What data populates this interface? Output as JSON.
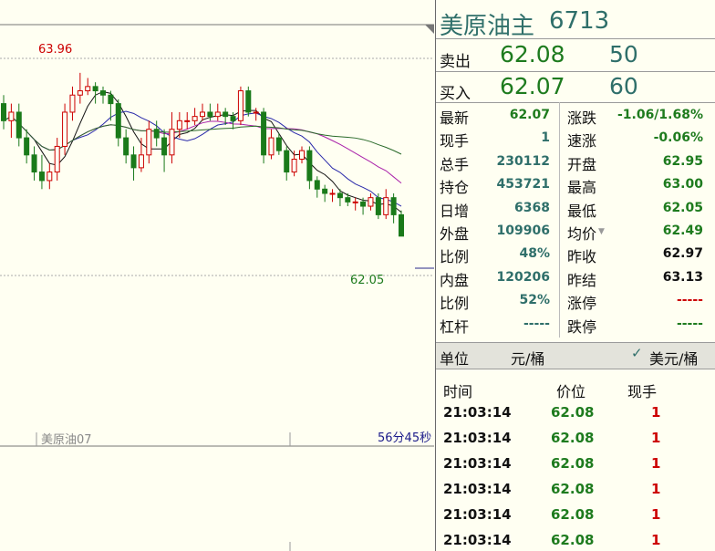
{
  "chart": {
    "high_label": "63.96",
    "low_label": "62.05",
    "contract_label": "美原油07",
    "countdown_label": "56分45秒"
  },
  "chart_data": {
    "type": "candlestick",
    "high": 63.96,
    "low": 62.05,
    "ylim": [
      61.6,
      64.3
    ],
    "candles": [
      [
        63.6,
        63.4,
        63.7,
        63.3
      ],
      [
        63.4,
        63.5,
        63.6,
        63.2
      ],
      [
        63.5,
        63.2,
        63.6,
        63.1
      ],
      [
        63.2,
        63.0,
        63.3,
        62.9
      ],
      [
        63.0,
        62.8,
        63.1,
        62.7
      ],
      [
        62.8,
        62.7,
        63.0,
        62.6
      ],
      [
        62.7,
        62.8,
        62.9,
        62.6
      ],
      [
        62.8,
        63.1,
        63.2,
        62.7
      ],
      [
        63.1,
        63.5,
        63.6,
        63.0
      ],
      [
        63.5,
        63.7,
        63.8,
        63.4
      ],
      [
        63.7,
        63.75,
        63.96,
        63.6
      ],
      [
        63.75,
        63.8,
        63.9,
        63.7
      ],
      [
        63.8,
        63.75,
        63.85,
        63.6
      ],
      [
        63.75,
        63.7,
        63.8,
        63.6
      ],
      [
        63.7,
        63.6,
        63.75,
        63.4
      ],
      [
        63.6,
        63.2,
        63.65,
        63.1
      ],
      [
        63.2,
        63.0,
        63.3,
        62.9
      ],
      [
        63.0,
        62.85,
        63.1,
        62.7
      ],
      [
        62.85,
        63.0,
        63.2,
        62.8
      ],
      [
        63.0,
        63.3,
        63.4,
        62.9
      ],
      [
        63.3,
        63.2,
        63.4,
        63.1
      ],
      [
        63.2,
        63.0,
        63.3,
        62.8
      ],
      [
        63.0,
        63.3,
        63.5,
        62.9
      ],
      [
        63.3,
        63.4,
        63.5,
        63.2
      ],
      [
        63.4,
        63.4,
        63.5,
        63.3
      ],
      [
        63.4,
        63.45,
        63.55,
        63.35
      ],
      [
        63.45,
        63.5,
        63.6,
        63.4
      ],
      [
        63.5,
        63.45,
        63.6,
        63.4
      ],
      [
        63.45,
        63.5,
        63.6,
        63.4
      ],
      [
        63.5,
        63.45,
        63.55,
        63.35
      ],
      [
        63.45,
        63.4,
        63.5,
        63.3
      ],
      [
        63.4,
        63.75,
        63.8,
        63.35
      ],
      [
        63.75,
        63.5,
        63.8,
        63.45
      ],
      [
        63.5,
        63.5,
        63.55,
        63.4
      ],
      [
        63.5,
        63.0,
        63.55,
        62.9
      ],
      [
        63.0,
        63.2,
        63.3,
        62.95
      ],
      [
        63.2,
        63.05,
        63.25,
        63.0
      ],
      [
        63.05,
        62.8,
        63.1,
        62.7
      ],
      [
        62.8,
        62.95,
        63.05,
        62.75
      ],
      [
        62.95,
        63.05,
        63.1,
        62.9
      ],
      [
        63.05,
        62.7,
        63.1,
        62.6
      ],
      [
        62.7,
        62.6,
        62.75,
        62.5
      ],
      [
        62.6,
        62.55,
        62.65,
        62.45
      ],
      [
        62.55,
        62.55,
        62.6,
        62.45
      ],
      [
        62.55,
        62.5,
        62.6,
        62.4
      ],
      [
        62.5,
        62.45,
        62.55,
        62.4
      ],
      [
        62.45,
        62.45,
        62.5,
        62.35
      ],
      [
        62.45,
        62.4,
        62.5,
        62.3
      ],
      [
        62.4,
        62.5,
        62.55,
        62.35
      ],
      [
        62.5,
        62.3,
        62.55,
        62.25
      ],
      [
        62.3,
        62.5,
        62.6,
        62.25
      ],
      [
        62.5,
        62.3,
        62.55,
        62.2
      ],
      [
        62.3,
        62.05,
        62.35,
        62.05
      ]
    ]
  },
  "header": {
    "name": "美原油主",
    "code": "6713"
  },
  "quote": {
    "sell_label": "卖出",
    "sell_price": "62.08",
    "sell_vol": "50",
    "buy_label": "买入",
    "buy_price": "62.07",
    "buy_vol": "60"
  },
  "stats": [
    {
      "l": "最新",
      "lv": "62.07",
      "lc": "#1e7b1e",
      "r": "涨跌",
      "rv": "-1.06/1.68%",
      "rc": "#1e7b1e"
    },
    {
      "l": "现手",
      "lv": "1",
      "lc": "#2f6f6a",
      "r": "速涨",
      "rv": "-0.06%",
      "rc": "#1e7b1e"
    },
    {
      "l": "总手",
      "lv": "230112",
      "lc": "#2f6f6a",
      "r": "开盘",
      "rv": "62.95",
      "rc": "#1e7b1e"
    },
    {
      "l": "持仓",
      "lv": "453721",
      "lc": "#2f6f6a",
      "r": "最高",
      "rv": "63.00",
      "rc": "#1e7b1e"
    },
    {
      "l": "日增",
      "lv": "6368",
      "lc": "#2f6f6a",
      "r": "最低",
      "rv": "62.05",
      "rc": "#1e7b1e"
    },
    {
      "l": "外盘",
      "lv": "109906",
      "lc": "#2f6f6a",
      "r": "均价",
      "rv": "62.49",
      "rc": "#1e7b1e"
    },
    {
      "l": "比例",
      "lv": "48%",
      "lc": "#2f6f6a",
      "r": "昨收",
      "rv": "62.97",
      "rc": "#111111"
    },
    {
      "l": "内盘",
      "lv": "120206",
      "lc": "#2f6f6a",
      "r": "昨结",
      "rv": "63.13",
      "rc": "#111111"
    },
    {
      "l": "比例",
      "lv": "52%",
      "lc": "#2f6f6a",
      "r": "涨停",
      "rv": "-----",
      "rc": "#cc0000"
    },
    {
      "l": "杠杆",
      "lv": "-----",
      "lc": "#2f6f6a",
      "r": "跌停",
      "rv": "-----",
      "rc": "#1e7b1e"
    }
  ],
  "unit": {
    "label": "单位",
    "value": "元/桶",
    "alt": "美元/桶"
  },
  "ticks": {
    "headers": [
      "时间",
      "价位",
      "现手"
    ],
    "rows": [
      {
        "time": "21:03:14",
        "price": "62.08",
        "vol": "1"
      },
      {
        "time": "21:03:14",
        "price": "62.08",
        "vol": "1"
      },
      {
        "time": "21:03:14",
        "price": "62.08",
        "vol": "1"
      },
      {
        "time": "21:03:14",
        "price": "62.08",
        "vol": "1"
      },
      {
        "time": "21:03:14",
        "price": "62.08",
        "vol": "1"
      },
      {
        "time": "21:03:14",
        "price": "62.08",
        "vol": "1"
      }
    ]
  },
  "colors": {
    "up": "#cc0000",
    "down": "#1a7a1a",
    "accent": "#2f6f6a"
  }
}
